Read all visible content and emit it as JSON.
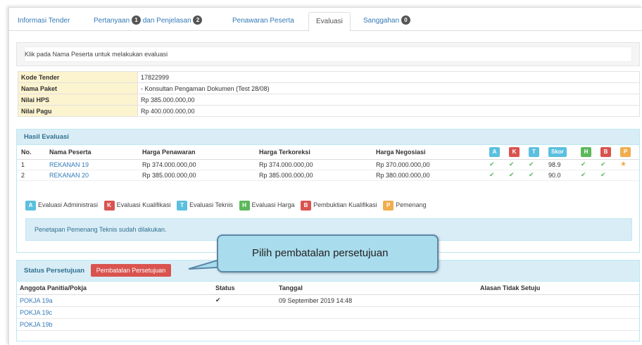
{
  "tabs": [
    {
      "label": "Informasi Tender"
    },
    {
      "label": "Pertanyaan",
      "badge": "1",
      "label2": "dan Penjelasan",
      "badge2": "2"
    },
    {
      "label": "Penawaran Peserta"
    },
    {
      "label": "Evaluasi",
      "active": true
    },
    {
      "label": "Sanggahan",
      "badge": "0"
    }
  ],
  "info_text": "Klik pada Nama Peserta untuk melakukan evaluasi",
  "details": [
    {
      "label": "Kode Tender",
      "value": "17822999"
    },
    {
      "label": "Nama Paket",
      "value": "- Konsultan Pengaman Dokumen (Test 28/08)"
    },
    {
      "label": "Nilai HPS",
      "value": "Rp 385.000.000,00"
    },
    {
      "label": "Nilai Pagu",
      "value": "Rp 400.000.000,00"
    }
  ],
  "hasil": {
    "title": "Hasil Evaluasi",
    "columns": [
      "No.",
      "Nama Peserta",
      "Harga Penawaran",
      "Harga Terkoreksi",
      "Harga Negosiasi"
    ],
    "eval_badges": [
      "A",
      "K",
      "T",
      "Skor",
      "H",
      "B",
      "P"
    ],
    "rows": [
      {
        "no": "1",
        "nama": "REKANAN 19",
        "penawaran": "Rp 374.000.000,00",
        "terkoreksi": "Rp 374.000.000,00",
        "negosiasi": "Rp 370.000.000,00",
        "skor": "98.9",
        "pemenang": true
      },
      {
        "no": "2",
        "nama": "REKANAN 20",
        "penawaran": "Rp 385.000.000,00",
        "terkoreksi": "Rp 385.000.000,00",
        "negosiasi": "Rp 380.000.000,00",
        "skor": "90.0",
        "pemenang": false
      }
    ],
    "legend": [
      {
        "badge": "A",
        "label": "Evaluasi Administrasi",
        "color": "#5bc0de"
      },
      {
        "badge": "K",
        "label": "Evaluasi Kualifikasi",
        "color": "#d9534f"
      },
      {
        "badge": "T",
        "label": "Evaluasi Teknis",
        "color": "#5bc0de"
      },
      {
        "badge": "H",
        "label": "Evaluasi Harga",
        "color": "#5cb85c"
      },
      {
        "badge": "B",
        "label": "Pembuktian Kualifikasi",
        "color": "#d9534f"
      },
      {
        "badge": "P",
        "label": "Pemenang",
        "color": "#f0ad4e"
      }
    ],
    "note": "Penetapan Pemenang Teknis sudah dilakukan."
  },
  "status": {
    "title": "Status Persetujuan",
    "button": "Pembatalan Persetujuan",
    "columns": [
      "Anggota Panitia/Pokja",
      "Status",
      "Tanggal",
      "Alasan Tidak Setuju"
    ],
    "rows": [
      {
        "nama": "POKJA 19a",
        "status": "✔",
        "tanggal": "09 September 2019 14:48",
        "alasan": ""
      },
      {
        "nama": "POKJA 19c",
        "status": "",
        "tanggal": "",
        "alasan": ""
      },
      {
        "nama": "POKJA 19b",
        "status": "",
        "tanggal": "",
        "alasan": ""
      }
    ]
  },
  "callout": "Pilih pembatalan persetujuan",
  "colors": {
    "accent": "#337ab7",
    "danger": "#d9534f",
    "info_panel": "#d9edf7",
    "callout": "#a9dcec"
  }
}
